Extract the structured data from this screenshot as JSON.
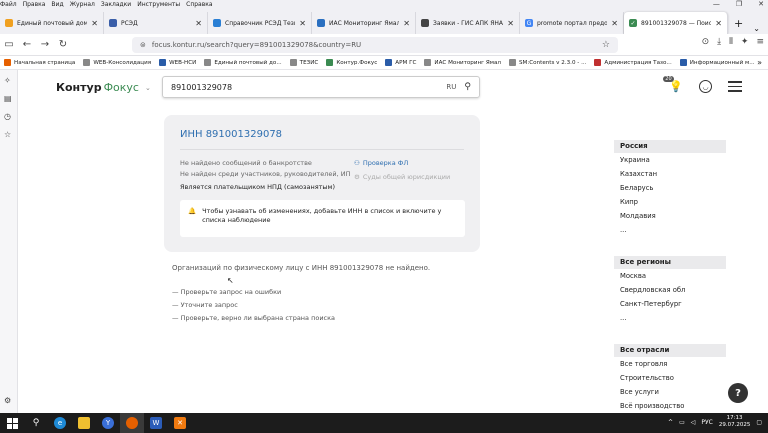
{
  "menu": [
    "Файл",
    "Правка",
    "Вид",
    "Журнал",
    "Закладки",
    "Инструменты",
    "Справка"
  ],
  "tabs": [
    {
      "title": "Единый почтовый домен",
      "color": "#f0a020"
    },
    {
      "title": "РСЭД",
      "color": "#3a5ea8"
    },
    {
      "title": "Справочник РСЭД Тезис",
      "color": "#2a7fd4"
    },
    {
      "title": "ИАС Мониторинг Ямал",
      "color": "#2a6fc0"
    },
    {
      "title": "Заявки - ГИС АПК ЯНАО",
      "color": "#444"
    },
    {
      "title": "promote портал предоста",
      "color": "#4285f4"
    },
    {
      "title": "891001329078 — Поиск",
      "color": "#3b8b52"
    }
  ],
  "url": "focus.kontur.ru/search?query=891001329078&country=RU",
  "bookmarks": [
    "Начальная страница",
    "WEB-Консолидация",
    "WEB-НСИ",
    "Единый почтовый до...",
    "ТЕЗИС",
    "Контур.Фокус",
    "АРМ ГС",
    "ИАС Мониторинг Ямал",
    "SM:Contents v 2.3.0 - ...",
    "Администрация Тазо...",
    "Информационный м..."
  ],
  "logo": {
    "a": "Контур",
    "b": "Фокус"
  },
  "search": {
    "value": "891001329078",
    "country": "RU"
  },
  "notif_count": "20",
  "card": {
    "title": "ИНН 891001329078",
    "line1": "Не найдено сообщений о банкротстве",
    "line2": "Не найден среди участников, руководителей, ИП",
    "line3": "Является плательщиком НПД (самозанятым)",
    "check": "Проверка ФЛ",
    "courts": "Суды общей юрисдикции",
    "notice": "Чтобы узнавать об изменениях, добавьте ИНН в список и включите у списка наблюдение"
  },
  "notfound": "Организаций по физическому лицу с ИНН 891001329078 не найдено.",
  "hints": [
    "— Проверьте запрос на ошибки",
    "— Уточните запрос",
    "— Проверьте, верно ли выбрана страна поиска"
  ],
  "countries": {
    "header": "Россия",
    "items": [
      "Украина",
      "Казахстан",
      "Беларусь",
      "Кипр",
      "Молдавия"
    ],
    "more": "..."
  },
  "regions": {
    "header": "Все регионы",
    "items": [
      "Москва",
      "Свердловская обл",
      "Санкт-Петербург"
    ],
    "more": "..."
  },
  "industries": {
    "header": "Все отрасли",
    "items": [
      "Все торговля",
      "Строительство",
      "Все услуги",
      "Всё производство"
    ]
  },
  "help": "?",
  "clock": {
    "time": "17:13",
    "date": "29.07.2025"
  },
  "lang": "РУС"
}
